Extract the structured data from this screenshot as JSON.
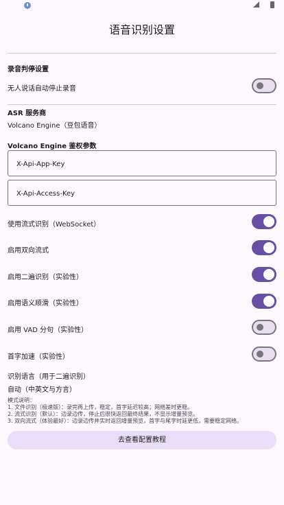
{
  "page": {
    "title": "语音识别设置"
  },
  "record_stop": {
    "section_title": "录音判停设置",
    "auto_stop_label": "无人说话自动停止录音",
    "auto_stop_on": false
  },
  "asr": {
    "section_title": "ASR 服务商",
    "provider_value": "Volcano Engine（豆包语音）"
  },
  "auth": {
    "section_title": "Volcano Engine 鉴权参数",
    "app_key_placeholder": "X-Api-App-Key",
    "access_key_placeholder": "X-Api-Access-Key"
  },
  "toggles": {
    "streaming": {
      "label": "使用流式识别（WebSocket）",
      "on": true
    },
    "bidirectional": {
      "label": "启用双向流式",
      "on": true
    },
    "second_pass": {
      "label": "启用二遍识别（实验性）",
      "on": true
    },
    "semantic_smooth": {
      "label": "启用语义顺滑（实验性）",
      "on": true
    },
    "vad_split": {
      "label": "启用 VAD 分句（实验性）",
      "on": false
    },
    "first_char_speedup": {
      "label": "首字加速（实验性）",
      "on": false
    }
  },
  "language": {
    "label": "识别语言（用于二遍识别）",
    "value": "自动（中英文与方言）"
  },
  "mode_note": {
    "heading": "模式说明：",
    "line1": "1. 文件识别（极速版）：录完再上传，稳定，首字延迟较高；网络差时更稳。",
    "line2": "2. 流式识别（默认）：边录边传，停止后很快返回最终结果，不显示增量预览。",
    "line3": "3. 双向流式（体验最好）：边录边传并实时返回增量预览，首字与尾字时延更低，需要稳定网络。"
  },
  "tutorial_button": {
    "label": "去查看配置教程"
  }
}
